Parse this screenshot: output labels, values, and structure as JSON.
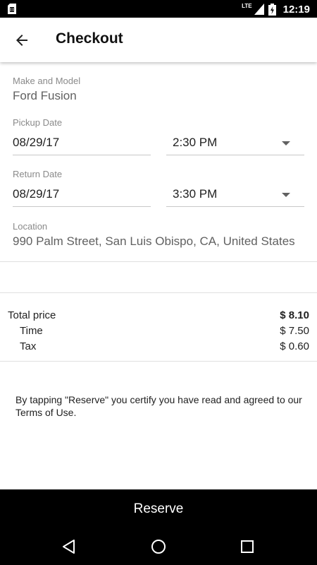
{
  "status_bar": {
    "network": "LTE",
    "time": "12:19",
    "icons": [
      "sim-card-icon",
      "signal-icon",
      "battery-charging-icon"
    ]
  },
  "app_bar": {
    "title": "Checkout",
    "back_icon": "arrow-back-icon"
  },
  "vehicle": {
    "label": "Make and Model",
    "value": "Ford Fusion"
  },
  "pickup": {
    "label": "Pickup Date",
    "date": "08/29/17",
    "time": "2:30 PM"
  },
  "return": {
    "label": "Return Date",
    "date": "08/29/17",
    "time": "3:30 PM"
  },
  "location": {
    "label": "Location",
    "value": "990 Palm Street, San Luis Obispo, CA, United States"
  },
  "price": {
    "total_label": "Total price",
    "total_value": "$ 8.10",
    "time_label": "Time",
    "time_value": "$ 7.50",
    "tax_label": "Tax",
    "tax_value": "$ 0.60"
  },
  "terms_text": "By tapping \"Reserve\" you certify you have read and agreed to our Terms of Use.",
  "reserve_label": "Reserve",
  "nav": [
    "back-triangle-icon",
    "home-circle-icon",
    "recents-square-icon"
  ]
}
